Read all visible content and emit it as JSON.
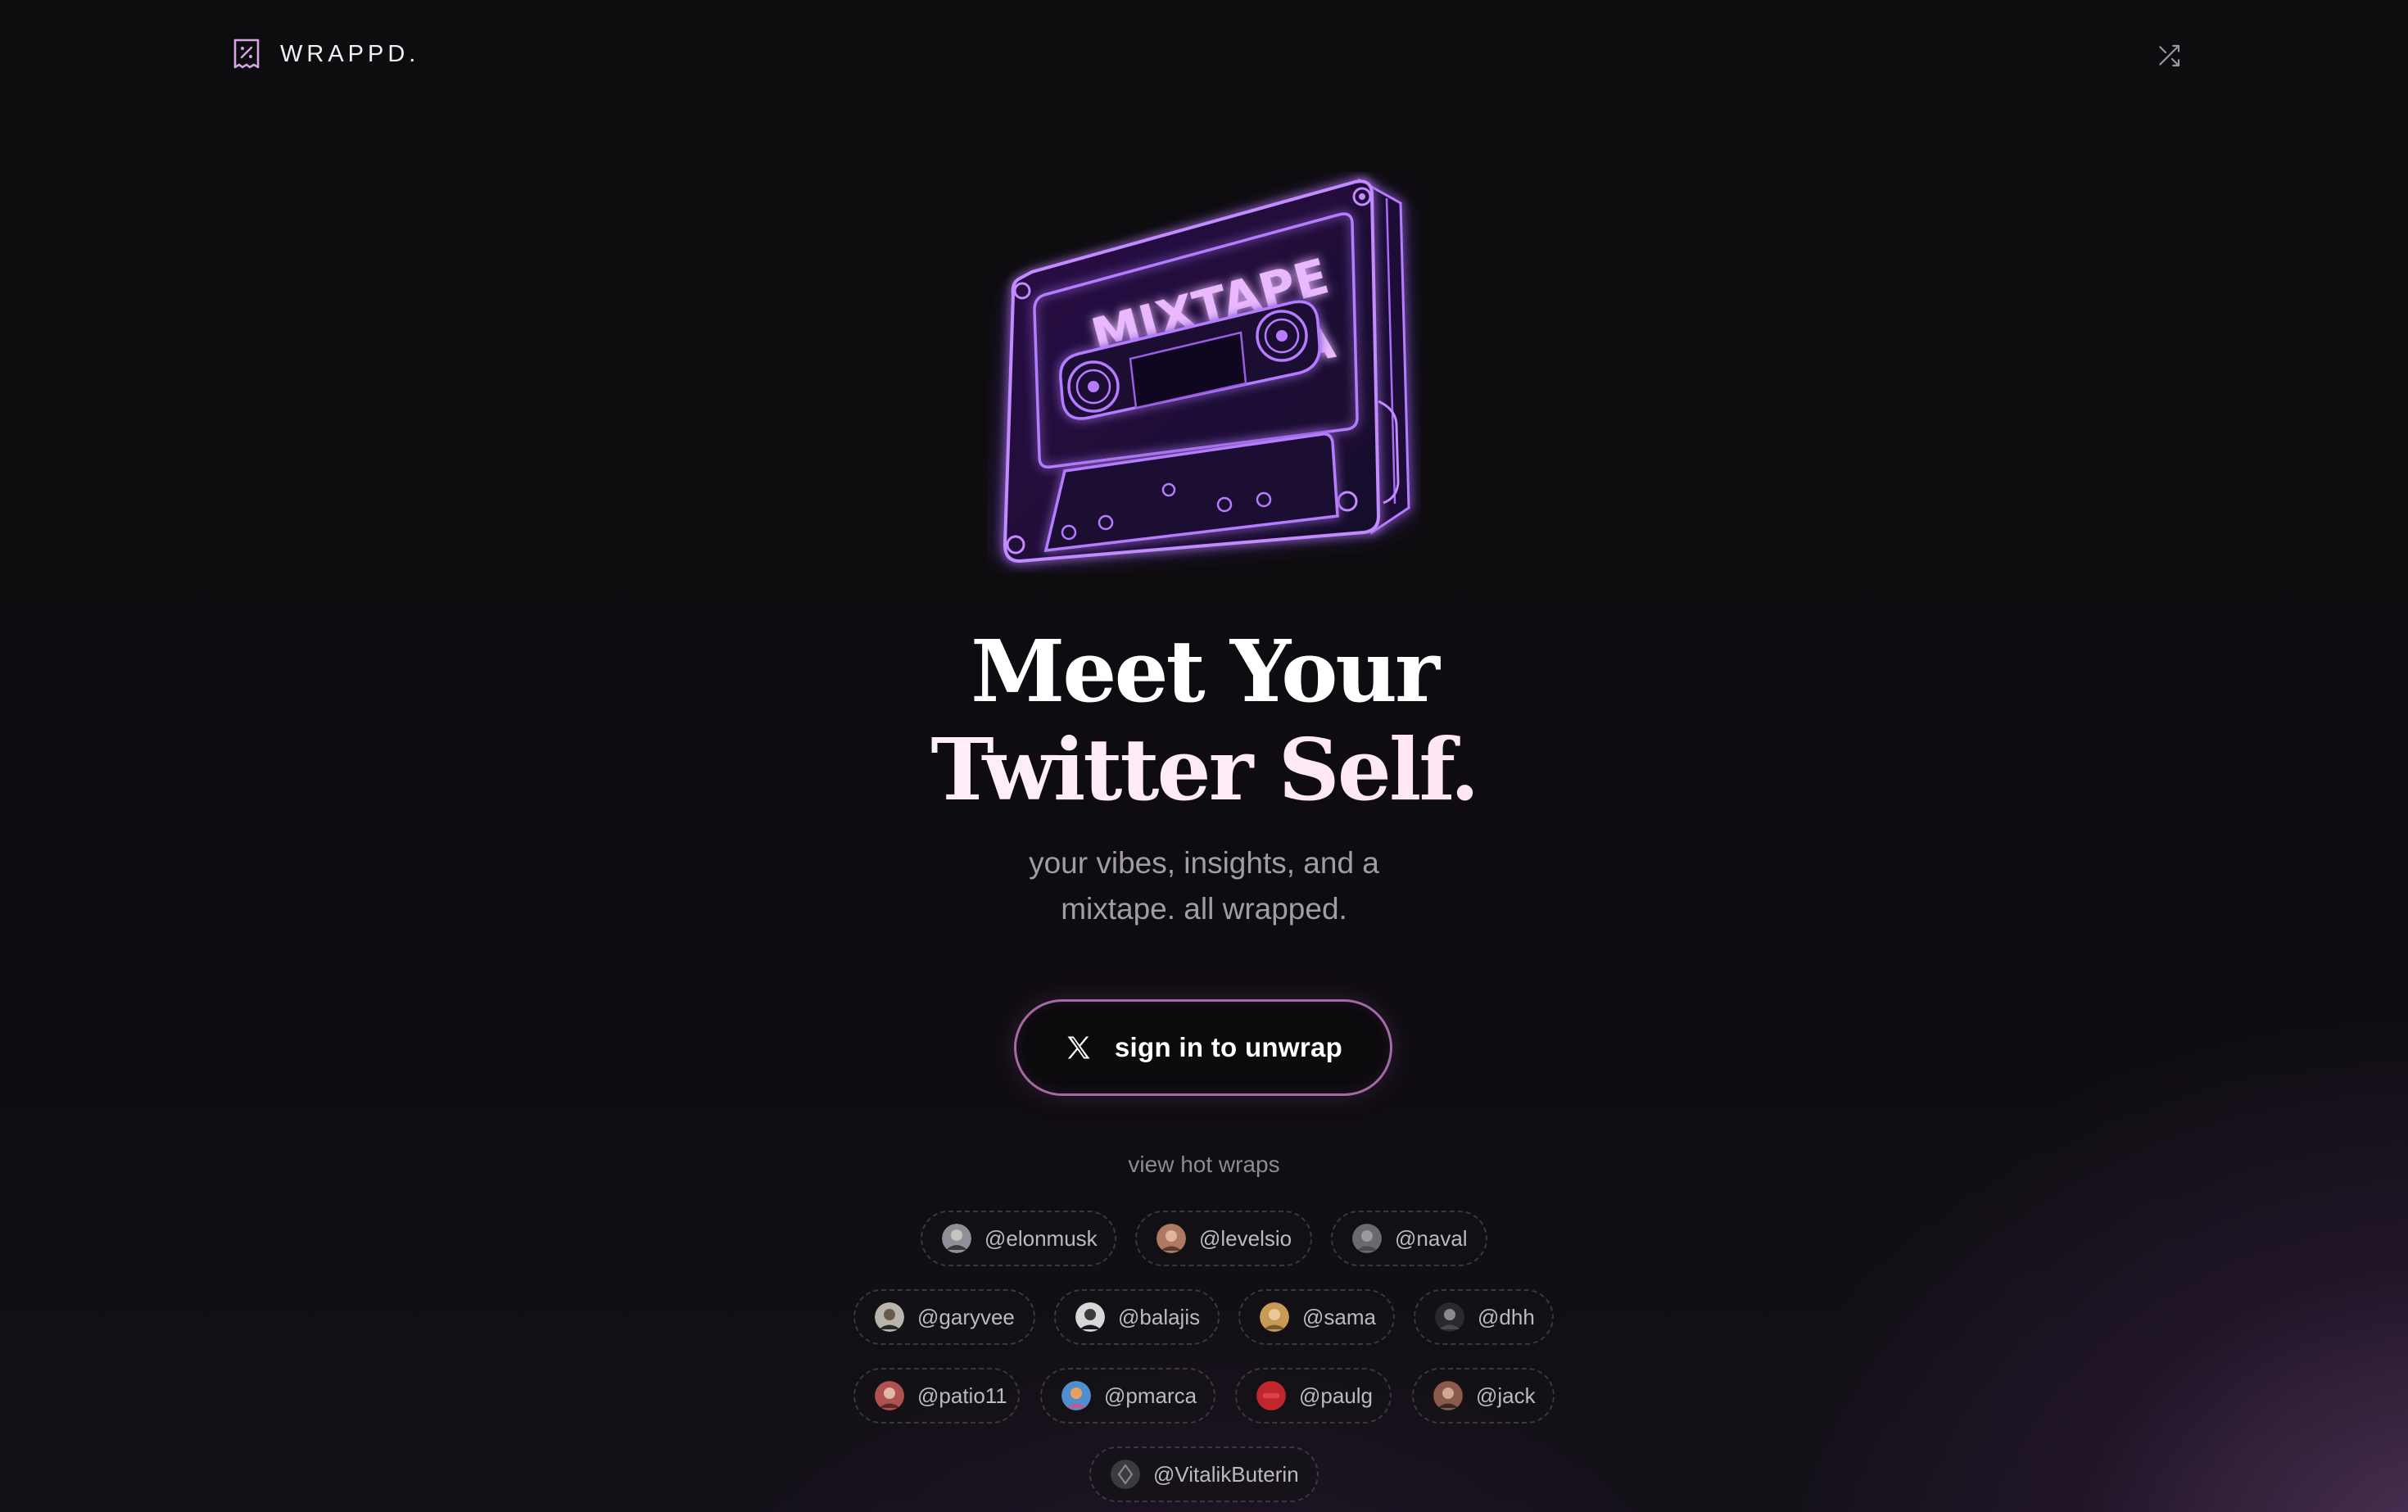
{
  "header": {
    "brand_name": "WRAPPD.",
    "brand_icon": "receipt-percent-icon",
    "shuffle_icon": "shuffle-icon"
  },
  "hero": {
    "illustration": "neon-cassette-tape",
    "cassette_label": "MIXTAPE",
    "cassette_side": "A",
    "headline_line1": "Meet Your",
    "headline_line2": "Twitter Self.",
    "subtitle_line1": "your vibes, insights, and a",
    "subtitle_line2": "mixtape. all wrapped."
  },
  "cta": {
    "label": "sign in to unwrap",
    "icon": "x-logo-icon"
  },
  "hot_wraps": {
    "label": "view hot wraps",
    "handles": [
      {
        "handle": "@elonmusk",
        "avatar_color": "#8f8f96"
      },
      {
        "handle": "@levelsio",
        "avatar_color": "#b07a62"
      },
      {
        "handle": "@naval",
        "avatar_color": "#6a6a6e"
      },
      {
        "handle": "@garyvee",
        "avatar_color": "#b9b4ad"
      },
      {
        "handle": "@balajis",
        "avatar_color": "#d8d8d8"
      },
      {
        "handle": "@sama",
        "avatar_color": "#c79a55"
      },
      {
        "handle": "@dhh",
        "avatar_color": "#2a2a2c"
      },
      {
        "handle": "@patio11",
        "avatar_color": "#b05050"
      },
      {
        "handle": "@pmarca",
        "avatar_color": "#4f8fd0"
      },
      {
        "handle": "@paulg",
        "avatar_color": "#c0262c"
      },
      {
        "handle": "@jack",
        "avatar_color": "#8a5a4a"
      },
      {
        "handle": "@VitalikButerin",
        "avatar_color": "#3a3a40"
      }
    ]
  },
  "colors": {
    "background": "#0d0c0e",
    "neon_purple": "#a855f7",
    "cta_border": "#a56aa6",
    "muted_text": "#a19da6"
  }
}
